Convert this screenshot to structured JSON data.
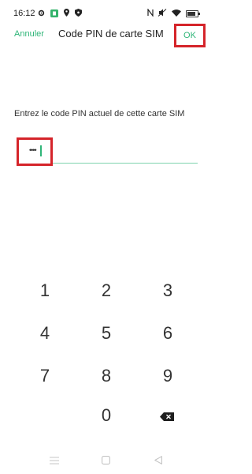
{
  "status_bar": {
    "time": "16:12",
    "left_icons": [
      "gear-icon",
      "app-notification-icon",
      "location-icon",
      "shield-icon"
    ],
    "right_icons": [
      "nfc-icon",
      "mute-icon",
      "wifi-icon",
      "battery-icon"
    ]
  },
  "header": {
    "cancel_label": "Annuler",
    "title": "Code PIN de carte SIM",
    "ok_label": "OK"
  },
  "form": {
    "instruction": "Entrez le code PIN actuel de cette carte SIM",
    "pin_masked": "••••"
  },
  "keypad": {
    "keys": [
      "1",
      "2",
      "3",
      "4",
      "5",
      "6",
      "7",
      "8",
      "9",
      "0"
    ],
    "backspace_icon": "backspace-icon"
  },
  "nav_bar": {
    "icons": [
      "menu-icon",
      "home-icon",
      "back-icon"
    ]
  },
  "colors": {
    "accent": "#2fb578",
    "highlight": "#d5242a"
  }
}
